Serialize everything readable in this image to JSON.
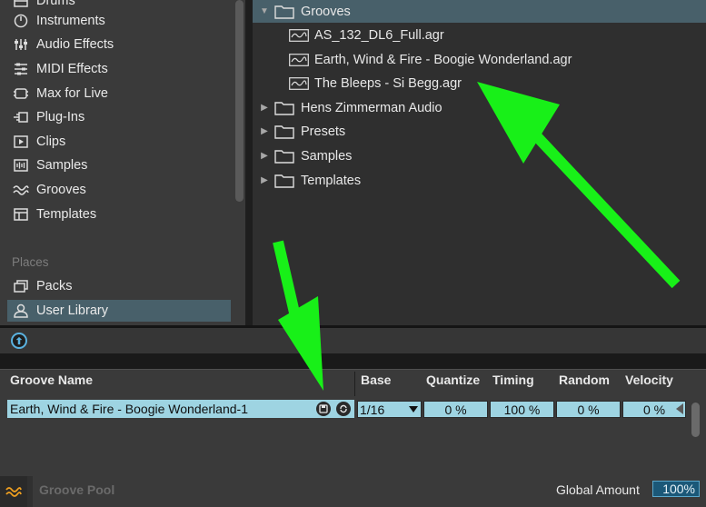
{
  "sidebar": {
    "items": [
      {
        "label": "Drums",
        "icon": "drums-icon"
      },
      {
        "label": "Instruments",
        "icon": "instruments-icon"
      },
      {
        "label": "Audio Effects",
        "icon": "audio-effects-icon"
      },
      {
        "label": "MIDI Effects",
        "icon": "midi-effects-icon"
      },
      {
        "label": "Max for Live",
        "icon": "max-for-live-icon"
      },
      {
        "label": "Plug-Ins",
        "icon": "plugins-icon"
      },
      {
        "label": "Clips",
        "icon": "clips-icon"
      },
      {
        "label": "Samples",
        "icon": "samples-icon"
      },
      {
        "label": "Grooves",
        "icon": "grooves-icon"
      },
      {
        "label": "Templates",
        "icon": "templates-icon"
      }
    ],
    "places_label": "Places",
    "places": [
      {
        "label": "Packs",
        "icon": "packs-icon"
      },
      {
        "label": "User Library",
        "icon": "user-library-icon"
      }
    ]
  },
  "browser": {
    "rows": [
      {
        "label": "Grooves",
        "kind": "folder",
        "expanded": true
      },
      {
        "label": "AS_132_DL6_Full.agr",
        "kind": "groove-file"
      },
      {
        "label": "Earth, Wind & Fire - Boogie Wonderland.agr",
        "kind": "groove-file"
      },
      {
        "label": "The Bleeps - Si Begg.agr",
        "kind": "groove-file"
      },
      {
        "label": "Hens Zimmerman Audio",
        "kind": "folder"
      },
      {
        "label": "Presets",
        "kind": "folder"
      },
      {
        "label": "Samples",
        "kind": "folder"
      },
      {
        "label": "Templates",
        "kind": "folder"
      }
    ]
  },
  "groove_pool": {
    "headers": {
      "name": "Groove Name",
      "base": "Base",
      "quantize": "Quantize",
      "timing": "Timing",
      "random": "Random",
      "velocity": "Velocity"
    },
    "row": {
      "name": "Earth, Wind & Fire - Boogie Wonderland-1",
      "base": "1/16",
      "quantize": "0 %",
      "timing": "100 %",
      "random": "0 %",
      "velocity": "0 %"
    },
    "title": "Groove Pool",
    "global_amount_label": "Global Amount",
    "global_amount_value": "100%"
  },
  "colors": {
    "selection": "#48606a",
    "row_highlight": "#9ed4e2",
    "accent_blue": "#5ab2e0",
    "annotation_green": "#18f018"
  }
}
